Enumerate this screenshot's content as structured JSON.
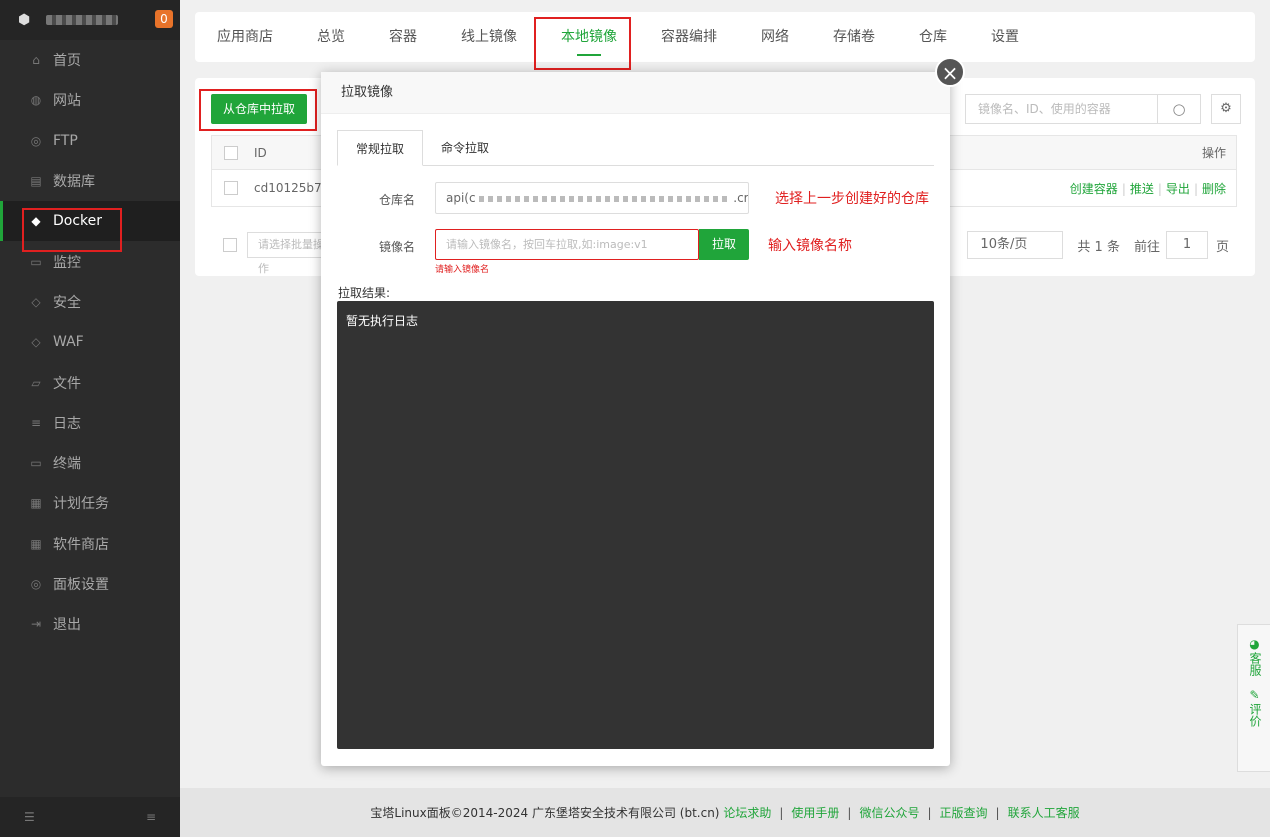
{
  "sidebar": {
    "badge": "0",
    "items": [
      {
        "label": "首页",
        "icon": "home-icon",
        "glyph": "⌂"
      },
      {
        "label": "网站",
        "icon": "globe-icon",
        "glyph": "◍"
      },
      {
        "label": "FTP",
        "icon": "ftp-icon",
        "glyph": "◎"
      },
      {
        "label": "数据库",
        "icon": "database-icon",
        "glyph": "▤"
      },
      {
        "label": "Docker",
        "icon": "docker-icon",
        "glyph": "◆"
      },
      {
        "label": "监控",
        "icon": "monitor-icon",
        "glyph": "▭"
      },
      {
        "label": "安全",
        "icon": "shield-icon",
        "glyph": "◇"
      },
      {
        "label": "WAF",
        "icon": "waf-shield-icon",
        "glyph": "◇"
      },
      {
        "label": "文件",
        "icon": "folder-icon",
        "glyph": "▱"
      },
      {
        "label": "日志",
        "icon": "log-icon",
        "glyph": "≡"
      },
      {
        "label": "终端",
        "icon": "terminal-icon",
        "glyph": "▭"
      },
      {
        "label": "计划任务",
        "icon": "calendar-icon",
        "glyph": "▦"
      },
      {
        "label": "软件商店",
        "icon": "apps-icon",
        "glyph": "▦"
      },
      {
        "label": "面板设置",
        "icon": "settings-icon",
        "glyph": "◎"
      },
      {
        "label": "退出",
        "icon": "logout-icon",
        "glyph": "⇥"
      }
    ],
    "active_index": 4
  },
  "top_tabs": [
    "应用商店",
    "总览",
    "容器",
    "线上镜像",
    "本地镜像",
    "容器编排",
    "网络",
    "存储卷",
    "仓库",
    "设置"
  ],
  "active_tab": "本地镜像",
  "panel": {
    "pull_button": "从仓库中拉取",
    "search_placeholder": "镜像名、ID、使用的容器",
    "table_headers": {
      "id": "ID",
      "ops": "操作"
    },
    "row": {
      "id": "cd10125b7c",
      "ops": [
        "创建容器",
        "推送",
        "导出",
        "删除"
      ]
    },
    "batch_placeholder": "请选择批量操作",
    "page_size": "10条/页",
    "total": "共 1 条",
    "goto": "前往",
    "page": "1",
    "page_unit": "页"
  },
  "modal": {
    "title": "拉取镜像",
    "tabs": [
      "常规拉取",
      "命令拉取"
    ],
    "repo_label": "仓库名",
    "repo_value": "api(c",
    "repo_suffix": ".cr",
    "image_label": "镜像名",
    "image_placeholder": "请输入镜像名，按回车拉取,如:image:v1",
    "pull_label": "拉取",
    "error": "请输入镜像名",
    "result_label": "拉取结果:",
    "console_text": "暂无执行日志",
    "note_repo": "选择上一步创建好的仓库",
    "note_image": "输入镜像名称"
  },
  "footer": {
    "copyright": "宝塔Linux面板©2014-2024 广东堡塔安全技术有限公司 (bt.cn)",
    "links": [
      "论坛求助",
      "使用手册",
      "微信公众号",
      "正版查询",
      "联系人工客服"
    ]
  },
  "float": [
    "客服",
    "评价"
  ],
  "colors": {
    "accent": "#20a53a",
    "annotation": "#e02020",
    "sidebar": "#2c2c2c"
  }
}
